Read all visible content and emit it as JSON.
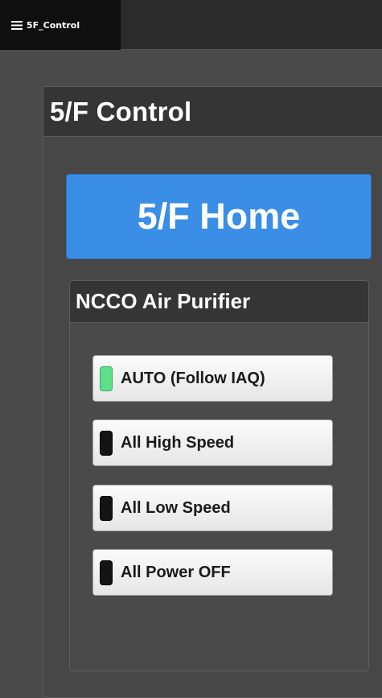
{
  "nav": {
    "tab_label": "5F_Control",
    "menu_icon": "hamburger-menu-icon"
  },
  "panel": {
    "title": "5/F Control"
  },
  "home_button": {
    "label": "5/F Home",
    "color": "#3a8ee6"
  },
  "air_purifier": {
    "title": "NCCO Air Purifier",
    "modes": [
      {
        "label": "AUTO (Follow IAQ)",
        "active": true
      },
      {
        "label": "All High Speed",
        "active": false
      },
      {
        "label": "All Low Speed",
        "active": false
      },
      {
        "label": "All Power OFF",
        "active": false
      }
    ]
  },
  "colors": {
    "indicator_on": "#5ee08a",
    "indicator_off": "#141414",
    "background": "#4a4a4a",
    "header": "#353535"
  }
}
